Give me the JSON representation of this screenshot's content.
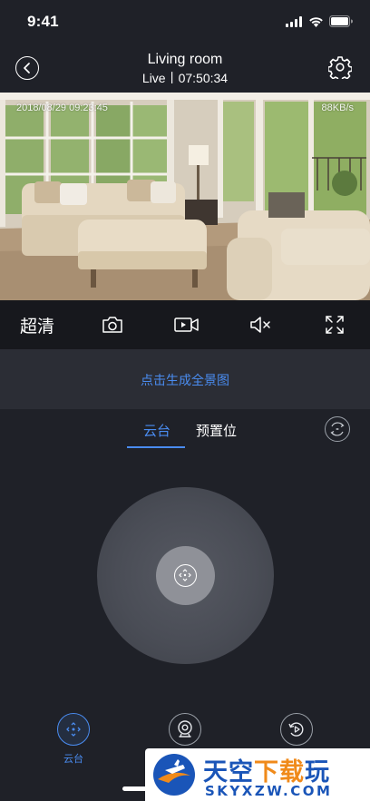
{
  "status_bar": {
    "time": "9:41"
  },
  "header": {
    "title": "Living room",
    "subtitle": "Live丨07:50:34"
  },
  "video": {
    "timestamp": "2018/08/29  09:23:45",
    "bitrate": "88KB/s"
  },
  "controls": {
    "quality": "超清"
  },
  "panorama": {
    "link": "点击生成全景图"
  },
  "tabs": [
    {
      "label": "云台",
      "active": true
    },
    {
      "label": "预置位",
      "active": false
    }
  ],
  "bottom_nav": {
    "ptz_label": "云台"
  },
  "watermark": {
    "cn_part1": "天空",
    "cn_part2": "下载",
    "cn_part3": "玩",
    "en": "SKYXZW.COM"
  },
  "colors": {
    "accent": "#4a8cf0",
    "background": "#1f2128",
    "panel": "#2b2d35",
    "toolbar": "#17181d"
  }
}
